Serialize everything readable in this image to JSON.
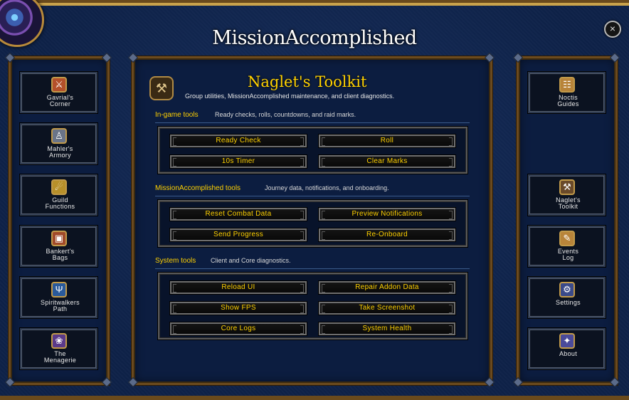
{
  "app": {
    "title": "MissionAccomplished",
    "close_symbol": "×"
  },
  "left_nav": [
    {
      "label": "Gavrial's\nCorner",
      "icon": "gavrial-icon",
      "glyph": "⚔",
      "icon_color": "#b4502a"
    },
    {
      "label": "Mahler's\nArmory",
      "icon": "armory-icon",
      "glyph": "♙",
      "icon_color": "#6a7488"
    },
    {
      "label": "Guild\nFunctions",
      "icon": "guild-icon",
      "glyph": "☄",
      "icon_color": "#b8902a"
    },
    {
      "label": "Bankert's\nBags",
      "icon": "bags-icon",
      "glyph": "▣",
      "icon_color": "#a04a2a"
    },
    {
      "label": "Spiritwalkers\nPath",
      "icon": "spiritwalker-icon",
      "glyph": "Ψ",
      "icon_color": "#2a5a9a"
    },
    {
      "label": "The\nMenagerie",
      "icon": "menagerie-icon",
      "glyph": "❀",
      "icon_color": "#5a3a8a"
    }
  ],
  "right_nav": [
    {
      "label": "Noctis\nGuides",
      "icon": "guides-icon",
      "glyph": "☷",
      "icon_color": "#b8843a"
    },
    {
      "label": "Naglet's\nToolkit",
      "icon": "toolkit-icon",
      "glyph": "⚒",
      "icon_color": "#6a4a2a"
    },
    {
      "label": "Events\nLog",
      "icon": "events-log-icon",
      "glyph": "✎",
      "icon_color": "#b8843a"
    },
    {
      "label": "Settings",
      "icon": "settings-icon",
      "glyph": "⚙",
      "icon_color": "#3a4a8a"
    },
    {
      "label": "About",
      "icon": "about-icon",
      "glyph": "✦",
      "icon_color": "#4a4a9a"
    }
  ],
  "main": {
    "title": "Naglet's Toolkit",
    "description": "Group utilities, MissionAccomplished maintenance, and client diagnostics.",
    "icon_glyph": "⚒",
    "sections": [
      {
        "label": "In-game tools",
        "description": "Ready checks, rolls, countdowns, and raid marks.",
        "buttons": [
          "Ready Check",
          "Roll",
          "10s Timer",
          "Clear Marks"
        ]
      },
      {
        "label": "MissionAccomplished tools",
        "description": "Journey data, notifications, and onboarding.",
        "buttons": [
          "Reset Combat Data",
          "Preview Notifications",
          "Send Progress",
          "Re-Onboard"
        ]
      },
      {
        "label": "System tools",
        "description": "Client and Core diagnostics.",
        "buttons": [
          "Reload UI",
          "Repair Addon Data",
          "Show FPS",
          "Take Screenshot",
          "Core Logs",
          "System Health"
        ]
      }
    ]
  }
}
